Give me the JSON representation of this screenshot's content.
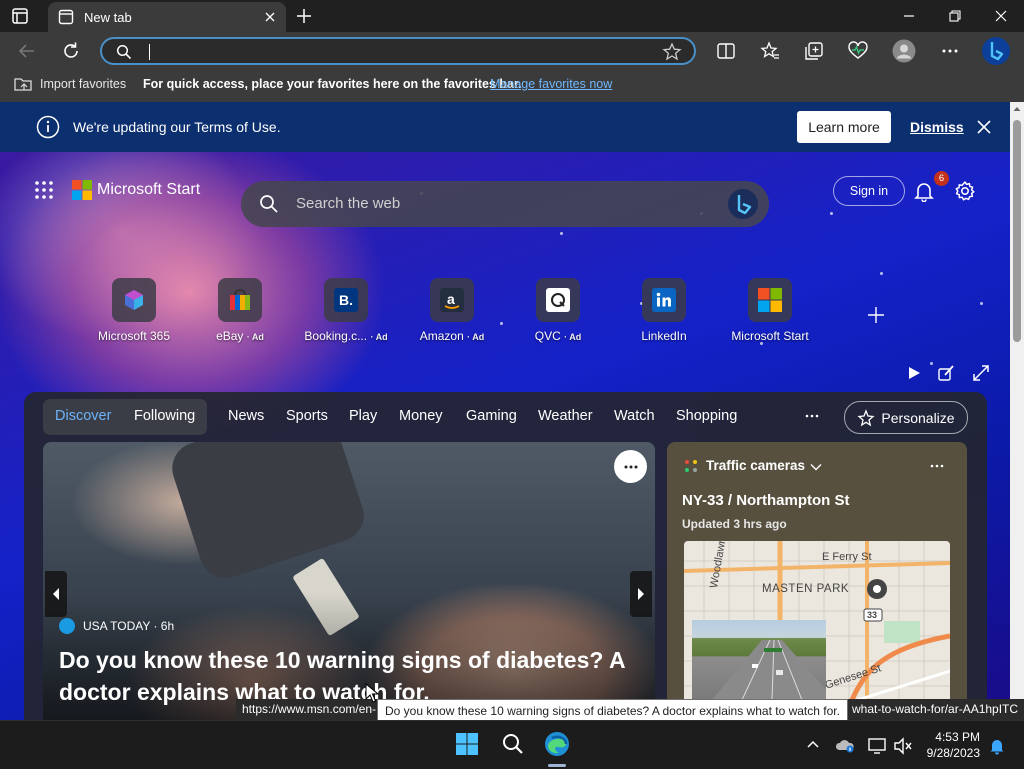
{
  "window": {
    "tab_title": "New tab"
  },
  "addressbar": {
    "value": ""
  },
  "favorites_bar": {
    "import_label": "Import favorites",
    "message": "For quick access, place your favorites here on the favorites bar.",
    "manage_link": "Manage favorites now"
  },
  "banner": {
    "message": "We're updating our Terms of Use.",
    "learn_more": "Learn more",
    "dismiss": "Dismiss"
  },
  "header": {
    "brand": "Microsoft Start",
    "search_placeholder": "Search the web",
    "sign_in": "Sign in",
    "notification_count": "6"
  },
  "quick_links": [
    {
      "label": "Microsoft 365",
      "ad": ""
    },
    {
      "label": "eBay",
      "ad": "· Ad"
    },
    {
      "label": "Booking.c...",
      "ad": "· Ad"
    },
    {
      "label": "Amazon",
      "ad": "· Ad"
    },
    {
      "label": "QVC",
      "ad": "· Ad"
    },
    {
      "label": "LinkedIn",
      "ad": ""
    },
    {
      "label": "Microsoft Start",
      "ad": ""
    }
  ],
  "feed_nav": {
    "discover": "Discover",
    "following": "Following",
    "items": [
      "News",
      "Sports",
      "Play",
      "Money",
      "Gaming",
      "Weather",
      "Watch",
      "Shopping"
    ],
    "personalize": "Personalize"
  },
  "article": {
    "source": "USA TODAY · 6h",
    "headline": "Do you know these 10 warning signs of diabetes? A doctor explains what to watch for."
  },
  "traffic": {
    "title": "Traffic cameras",
    "location": "NY-33 / Northampton St",
    "updated": "Updated 3 hrs ago",
    "map_labels": {
      "street1": "E Ferry St",
      "street2": "Woodlawn Ave",
      "area": "MASTEN PARK",
      "route": "33",
      "street3": "Genesee St"
    }
  },
  "status": {
    "url_left": "https://www.msn.com/en-",
    "tooltip": "Do you know these 10 warning signs of diabetes? A doctor explains what to watch for.",
    "url_right": "what-to-watch-for/ar-AA1hpITC"
  },
  "taskbar": {
    "time": "4:53 PM",
    "date": "9/28/2023"
  },
  "colors": {
    "accent": "#4a90c8",
    "banner": "#0c2f70",
    "link": "#6fb8ff",
    "badge": "#c4321c",
    "traffic_card": "#57503f"
  }
}
